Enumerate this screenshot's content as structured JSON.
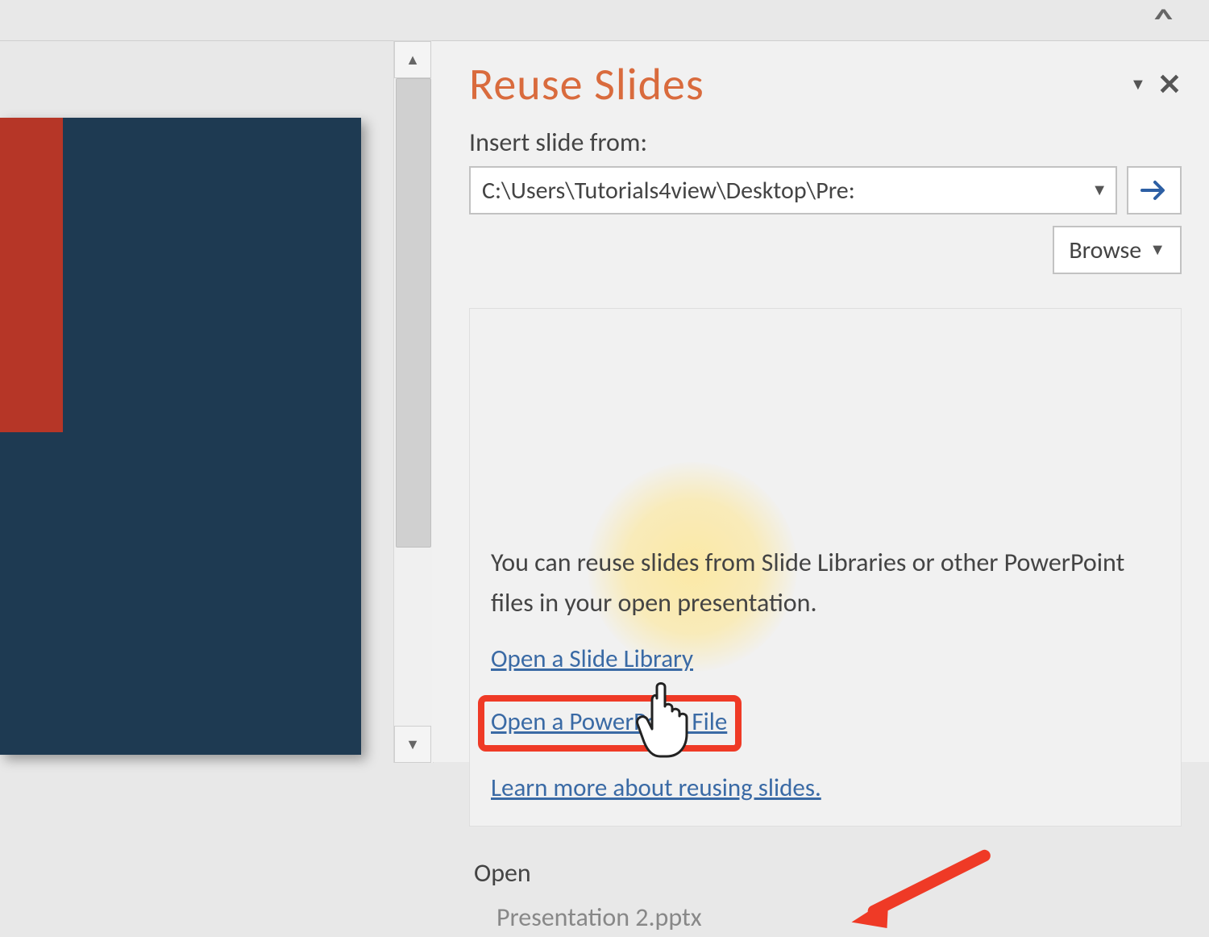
{
  "panel": {
    "title": "Reuse Slides",
    "insert_label": "Insert slide from:",
    "path_value": "C:\\Users\\Tutorials4view\\Desktop\\Pre:",
    "browse_label": "Browse",
    "info_text": "You can reuse slides from Slide Libraries or other PowerPoint files in your open presentation.",
    "link_slide_library": "Open a Slide Library",
    "link_powerpoint_file": "Open a PowerPoint File",
    "link_learn_more": "Learn more about reusing slides.",
    "open_section_title": "Open",
    "open_recent_item": "Presentation 2.pptx"
  },
  "colors": {
    "accent": "#d96b3d",
    "link": "#3a6aa5",
    "highlight_red": "#ef3a26",
    "dark_slide": "#1e3a52",
    "red_block": "#b63627"
  }
}
